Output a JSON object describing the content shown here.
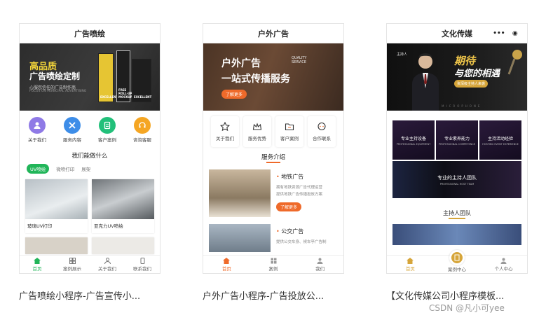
{
  "cards": [
    {
      "title": "广告喷绘",
      "banner": {
        "line1": "高品质",
        "line2": "广告喷绘定制",
        "line3": "心服您信任的广告制作商",
        "line4": "FOCUS ON MUNICIPAL ADVERTISING",
        "posters": [
          "EXCELLENT",
          "FREE ROLL-UP MOCKUP",
          "EXCELLENT"
        ]
      },
      "icons": [
        "关于我们",
        "服务内容",
        "客户案例",
        "咨询客服"
      ],
      "section_title": "我们能做什么",
      "pills": [
        "UV喷绘",
        "微喷打印",
        "展架"
      ],
      "items": [
        "玻璃UV打印",
        "亚克力UV喷绘"
      ],
      "tabs": [
        "首页",
        "案例展示",
        "关于我们",
        "联系我们"
      ]
    },
    {
      "title": "户外广告",
      "banner": {
        "line1": "户外广告",
        "line1_sub": "QUALITY SERVICE",
        "line2": "一站式传播服务",
        "button": "了解更多"
      },
      "icons": [
        "关于我们",
        "服务优势",
        "客户案例",
        "合作联系"
      ],
      "section_title": "服务介绍",
      "services": [
        {
          "title": "地铁广告",
          "desc1": "拥有地铁资源广告代理运营",
          "desc2": "提供地铁广告传播投放方案",
          "button": "了解更多"
        },
        {
          "title": "公交广告",
          "desc1": "提供公交车身、候车亭广告制"
        }
      ],
      "tabs": [
        "首页",
        "案例",
        "我们"
      ]
    },
    {
      "title": "文化传媒",
      "capsule": [
        "•••",
        "◉"
      ],
      "banner": {
        "name": "主持人",
        "line1": "期待",
        "line2": "与您的相遇",
        "button": "资深级主持人来袭",
        "footer": "MICROPHONE"
      },
      "grid": [
        {
          "title": "专业主持设备",
          "sub": "PROFESSIONAL EQUIPMENT"
        },
        {
          "title": "专业素养能力",
          "sub": "PROFESSIONAL COMPETENCE"
        },
        {
          "title": "主持活动经验",
          "sub": "HOSTING EVENT EXPERIENCE"
        }
      ],
      "wide": {
        "title": "专业的主持人团队",
        "sub": "PROFESSIONAL HOST TEAM"
      },
      "section_title": "主持人团队",
      "tabs": [
        "首页",
        "案例中心",
        "个人中心"
      ]
    }
  ],
  "captions": [
    "广告喷绘小程序-广告宣传小...",
    "户外广告小程序-广告投放公...",
    "【文化传媒公司小程序模板..."
  ],
  "watermark": "CSDN @凡小可yee",
  "colors": {
    "green": "#21b559",
    "orange": "#ef6a2a",
    "gold": "#d6a53a"
  }
}
